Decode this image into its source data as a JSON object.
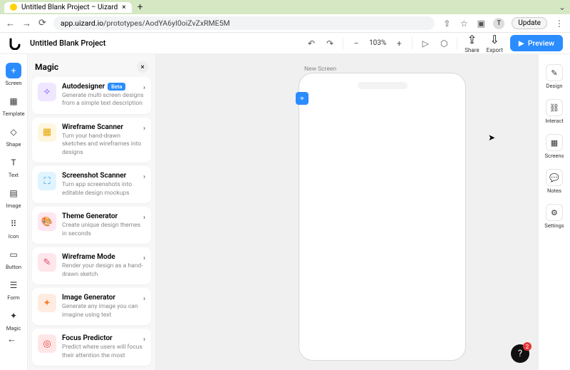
{
  "browser": {
    "tab_title": "Untitled Blank Project – Uizard",
    "url_domain": "app.uizard.io",
    "url_path": "/prototypes/AodYA6yI0oiZvZxRME5M",
    "update_label": "Update",
    "avatar_initial": "T"
  },
  "topbar": {
    "project_title": "Untitled Blank Project",
    "zoom": "103%",
    "share_label": "Share",
    "export_label": "Export",
    "preview_label": "Preview"
  },
  "left_tools": [
    {
      "label": "Screen",
      "glyph": "+",
      "active": true
    },
    {
      "label": "Template",
      "glyph": "▦"
    },
    {
      "label": "Shape",
      "glyph": "◇"
    },
    {
      "label": "Text",
      "glyph": "T"
    },
    {
      "label": "Image",
      "glyph": "▤"
    },
    {
      "label": "Icon",
      "glyph": "⠿"
    },
    {
      "label": "Button",
      "glyph": "▭"
    },
    {
      "label": "Form",
      "glyph": "☰"
    },
    {
      "label": "Magic",
      "glyph": "✦"
    }
  ],
  "panel": {
    "title": "Magic",
    "items": [
      {
        "title": "Autodesigner",
        "badge": "Beta",
        "desc": "Generate multi screen designs from a simple text description",
        "icon_class": "ic-purple",
        "glyph": "✧"
      },
      {
        "title": "Wireframe Scanner",
        "desc": "Turn your hand-drawn sketches and wireframes into designs",
        "icon_class": "ic-yellow",
        "glyph": "▦"
      },
      {
        "title": "Screenshot Scanner",
        "desc": "Turn app screenshots into editable design mockups",
        "icon_class": "ic-cyan",
        "glyph": "⛶"
      },
      {
        "title": "Theme Generator",
        "desc": "Create unique design themes in seconds",
        "icon_class": "ic-pink",
        "glyph": "🎨"
      },
      {
        "title": "Wireframe Mode",
        "desc": "Render your design as a hand-drawn sketch",
        "icon_class": "ic-pink2",
        "glyph": "✎"
      },
      {
        "title": "Image Generator",
        "desc": "Generate any image you can imagine using text",
        "icon_class": "ic-orange",
        "glyph": "✦"
      },
      {
        "title": "Focus Predictor",
        "desc": "Predict where users will focus their attention the most",
        "icon_class": "ic-red",
        "glyph": "◎"
      }
    ]
  },
  "canvas": {
    "screen_label": "New Screen"
  },
  "right_tools": [
    {
      "label": "Design",
      "glyph": "✎"
    },
    {
      "label": "Interact",
      "glyph": "⛓"
    },
    {
      "label": "Screens",
      "glyph": "▦"
    },
    {
      "label": "Notes",
      "glyph": "💬"
    },
    {
      "label": "Settings",
      "glyph": "⚙"
    }
  ],
  "help_badge": "2"
}
